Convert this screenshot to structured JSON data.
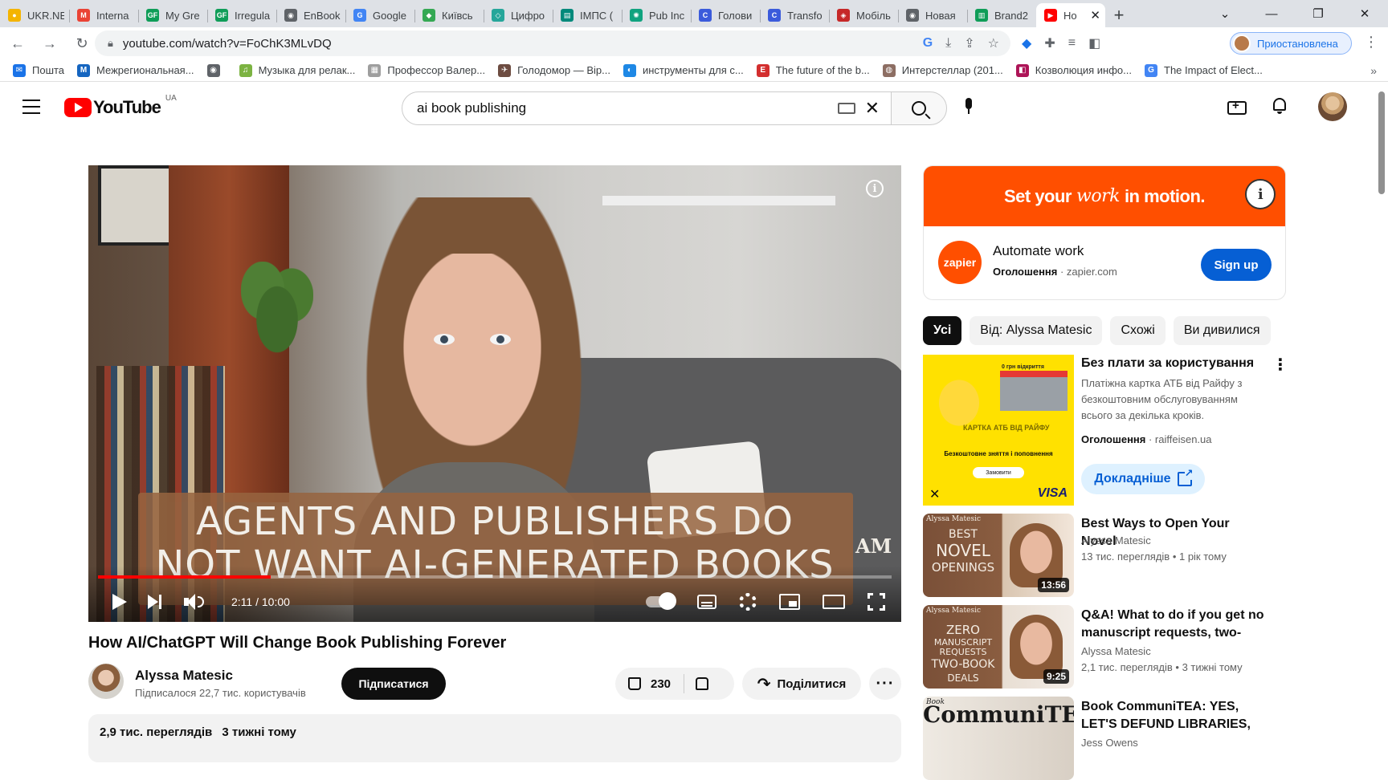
{
  "browser": {
    "tabs": [
      {
        "label": "UKR.NE",
        "color": "#f4b400",
        "glyph": "●"
      },
      {
        "label": "Interna",
        "color": "#ea4335",
        "glyph": "M"
      },
      {
        "label": "My Gre",
        "color": "#0f9d58",
        "glyph": "GF"
      },
      {
        "label": "Irregula",
        "color": "#0f9d58",
        "glyph": "GF"
      },
      {
        "label": "EnBook",
        "color": "#5f6368",
        "glyph": "◉"
      },
      {
        "label": "Google",
        "color": "#4285f4",
        "glyph": "G"
      },
      {
        "label": "Київсь",
        "color": "#34a853",
        "glyph": "◆"
      },
      {
        "label": "Цифро",
        "color": "#26a69a",
        "glyph": "◇"
      },
      {
        "label": "ІМПС (",
        "color": "#00897b",
        "glyph": "▤"
      },
      {
        "label": "Pub Inc",
        "color": "#10a37f",
        "glyph": "✺"
      },
      {
        "label": "Голови",
        "color": "#3b5bdb",
        "glyph": "C"
      },
      {
        "label": "Transfo",
        "color": "#3b5bdb",
        "glyph": "C"
      },
      {
        "label": "Мобіль",
        "color": "#c62828",
        "glyph": "◈"
      },
      {
        "label": "Новая",
        "color": "#5f6368",
        "glyph": "◉"
      },
      {
        "label": "Brand2",
        "color": "#0f9d58",
        "glyph": "▥"
      },
      {
        "label": "Ho",
        "color": "#ff0000",
        "glyph": "▶"
      }
    ],
    "window_controls": [
      "⌄",
      "—",
      "❐",
      "✕"
    ],
    "url": "youtube.com/watch?v=FoChK3MLvDQ",
    "profile_label": "Приостановлена",
    "bookmarks": [
      {
        "label": "Пошта",
        "color": "#1a73e8",
        "glyph": "✉"
      },
      {
        "label": "Межрегиональная...",
        "color": "#1565c0",
        "glyph": "M"
      },
      {
        "label": "",
        "color": "#5f6368",
        "glyph": "◉"
      },
      {
        "label": "Музыка для релак...",
        "color": "#7cb342",
        "glyph": "♫"
      },
      {
        "label": "Профессор Валер...",
        "color": "#9e9e9e",
        "glyph": "▦"
      },
      {
        "label": "Голодомор — Вір...",
        "color": "#6d4c41",
        "glyph": "✈"
      },
      {
        "label": "инструменты для с...",
        "color": "#1e88e5",
        "glyph": "◐"
      },
      {
        "label": "The future of the b...",
        "color": "#d32f2f",
        "glyph": "E"
      },
      {
        "label": "Интерстеллар (201...",
        "color": "#8d6e63",
        "glyph": "◍"
      },
      {
        "label": "Козволюция инфо...",
        "color": "#ad1457",
        "glyph": "◧"
      },
      {
        "label": "The Impact of Elect...",
        "color": "#4285f4",
        "glyph": "G"
      }
    ]
  },
  "youtube": {
    "logo_text": "YouTube",
    "country_code": "UA",
    "search_query": "ai book publishing"
  },
  "video": {
    "caption_line1": "AGENTS AND PUBLISHERS DO",
    "caption_line2": "NOT WANT AI-GENERATED BOOKS",
    "watermark": "AM",
    "time": "2:11 / 10:00",
    "progress": 0.218,
    "title": "How AI/ChatGPT Will Change Book Publishing Forever",
    "channel": "Alyssa Matesic",
    "subscribers": "Підписалося 22,7 тис. користувачів",
    "subscribe_label": "Підписатися",
    "likes": "230",
    "share_label": "Поділитися",
    "more_label": "···",
    "views": "2,9 тис. переглядів",
    "posted": "3 тижні тому"
  },
  "ad": {
    "banner_pre": "Set your",
    "banner_em": "work",
    "banner_post": "in motion.",
    "logo_text": "zapier",
    "headline": "Automate work",
    "sponsored": "Оголошення",
    "domain": "zapier.com",
    "cta": "Sign up"
  },
  "chips": [
    "Усі",
    "Від: Alyssa Matesic",
    "Схожі",
    "Ви дивилися"
  ],
  "sponsored_card": {
    "thumb_store_label": "0 грн відкриття",
    "thumb_card_text": "КАРТКА АТБ ВІД РАЙФУ",
    "thumb_band": "Безкоштовне зняття і поповнення",
    "thumb_pill": "Замовити",
    "thumb_visa": "VISA",
    "title": "Без плати за користування",
    "description": "Платіжна картка АТБ від Райфу з безкоштовним обслуговуванням всього за декілька кроків.",
    "sponsored": "Оголошення",
    "domain": "raiffeisen.ua",
    "cta": "Докладніше"
  },
  "related": [
    {
      "title": "Best Ways to Open Your Novel",
      "channel": "Alyssa Matesic",
      "meta": "13 тис. переглядів  • 1 рік тому",
      "duration": "13:56",
      "thumb_lines": [
        "BEST",
        "NOVEL",
        "OPENINGS"
      ],
      "thumb_logo": "Alyssa Matesic"
    },
    {
      "title": "Q&A! What to do if you get no manuscript requests, two-boo...",
      "channel": "Alyssa Matesic",
      "meta": "2,1 тис. переглядів  • 3 тижні тому",
      "duration": "9:25",
      "thumb_lines": [
        "ZERO",
        "MANUSCRIPT",
        "REQUESTS",
        "TWO-BOOK",
        "DEALS"
      ],
      "thumb_logo": "Alyssa Matesic"
    },
    {
      "title": "Book CommuniTEA: YES, LET'S DEFUND LIBRARIES, SEEMS...",
      "channel": "Jess Owens",
      "meta": "",
      "duration": "",
      "thumb_lines": [
        "CommuniTEA"
      ],
      "thumb_logo": "Book"
    }
  ]
}
